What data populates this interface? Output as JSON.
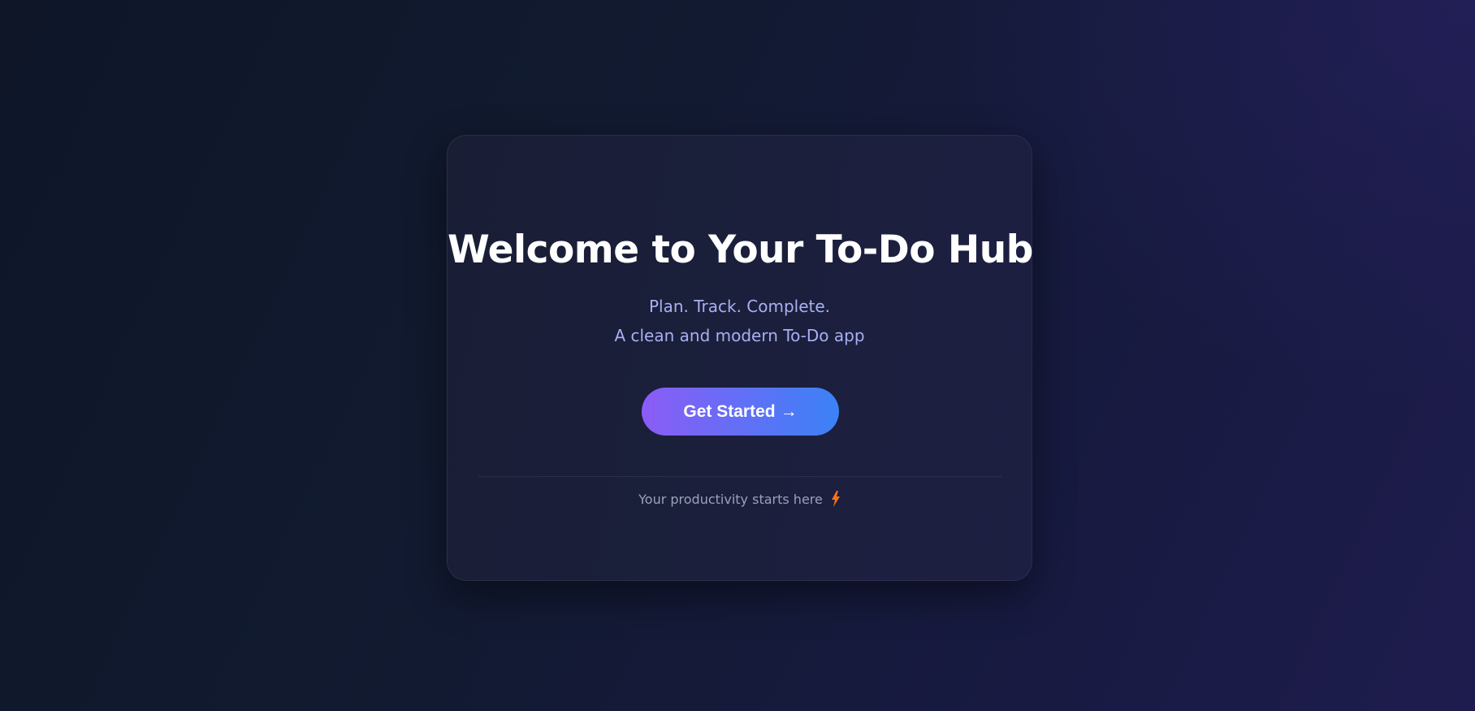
{
  "hero": {
    "title": "Welcome to Your To-Do Hub",
    "tagline": "Plan. Track. Complete.",
    "description": "A clean and modern To-Do app"
  },
  "cta": {
    "label": "Get Started",
    "arrow": "→"
  },
  "footer": {
    "text": "Your productivity starts here",
    "icon": "lightning-bolt-icon"
  },
  "colors": {
    "background": "#0e1628",
    "card": "#1b1f3c",
    "title": "#ffffff",
    "subtitle": "#a7b0f2",
    "button_start": "#8b5cf6",
    "button_end": "#3b82f6",
    "footer_text": "#9aa1b8",
    "bolt": "#f97316"
  }
}
